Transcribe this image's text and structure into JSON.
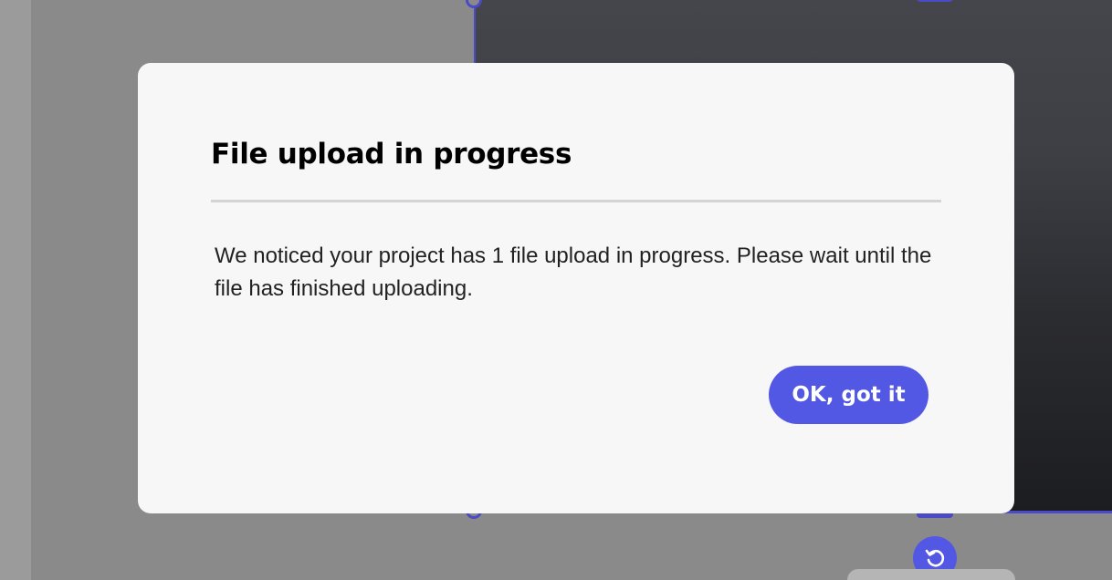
{
  "dialog": {
    "title": "File upload in progress",
    "message": "We noticed your project has 1 file upload in progress. Please wait until the file has finished uploading.",
    "confirm_label": "OK, got it"
  },
  "colors": {
    "accent": "#5258e4",
    "overlay": "#8a8a8a",
    "dialog_background": "#f7f7f7"
  },
  "icons": {
    "rotate": "rotate-icon"
  }
}
